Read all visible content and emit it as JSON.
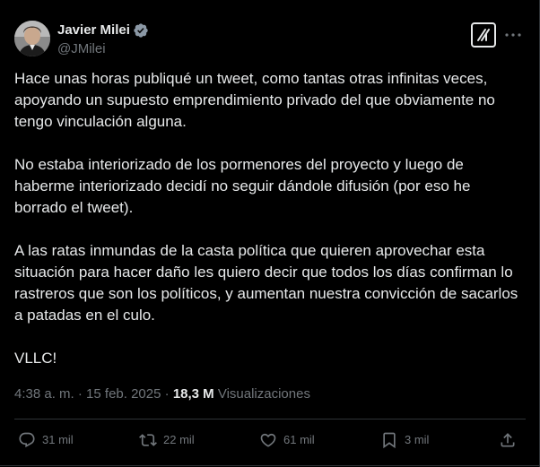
{
  "author": {
    "display_name": "Javier Milei",
    "handle": "@JMilei",
    "verified": true,
    "verified_color": "#8b98a5"
  },
  "header_icons": {
    "grok": "grok-icon",
    "more": "more-horizontal-icon"
  },
  "tweet": {
    "paragraphs": [
      "Hace unas horas publiqué un tweet, como tantas otras infinitas veces, apoyando un supuesto emprendimiento privado del que obviamente no tengo vinculación alguna.",
      "No estaba interiorizado de los pormenores del proyecto y luego de haberme interiorizado decidí no seguir dándole difusión (por eso he borrado el tweet).",
      "A las ratas inmundas de la casta política que quieren aprovechar esta situación para hacer daño les quiero decir que todos los días confirman lo rastreros que son los políticos, y aumentan nuestra convicción de sacarlos a patadas en el culo.",
      "VLLC!"
    ]
  },
  "meta": {
    "time": "4:38 a. m.",
    "separator": "·",
    "date": "15 feb. 2025",
    "views_count": "18,3 M",
    "views_label": "Visualizaciones"
  },
  "actions": {
    "replies": {
      "icon": "reply-icon",
      "count": "31 mil"
    },
    "reposts": {
      "icon": "repost-icon",
      "count": "22 mil"
    },
    "likes": {
      "icon": "heart-icon",
      "count": "61 mil"
    },
    "bookmarks": {
      "icon": "bookmark-icon",
      "count": "3 mil"
    },
    "share": {
      "icon": "share-icon"
    }
  },
  "colors": {
    "background": "#000000",
    "text_primary": "#e7e9ea",
    "text_secondary": "#71767b",
    "border": "#2f3336"
  }
}
